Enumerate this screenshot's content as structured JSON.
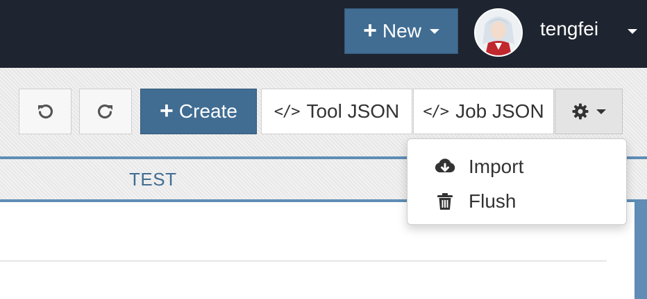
{
  "navbar": {
    "new_label": "New",
    "username": "tengfei"
  },
  "toolbar": {
    "create_label": "Create",
    "tool_json_label": "Tool JSON",
    "job_json_label": "Job JSON"
  },
  "tabs": [
    {
      "label": "TEST"
    }
  ],
  "settings_menu": {
    "items": [
      {
        "label": "Import",
        "icon": "cloud-download-icon"
      },
      {
        "label": "Flush",
        "icon": "trash-icon"
      }
    ]
  },
  "colors": {
    "navbar_bg": "#1e2530",
    "primary": "#416d93",
    "tab_accent": "#5f8db5"
  }
}
